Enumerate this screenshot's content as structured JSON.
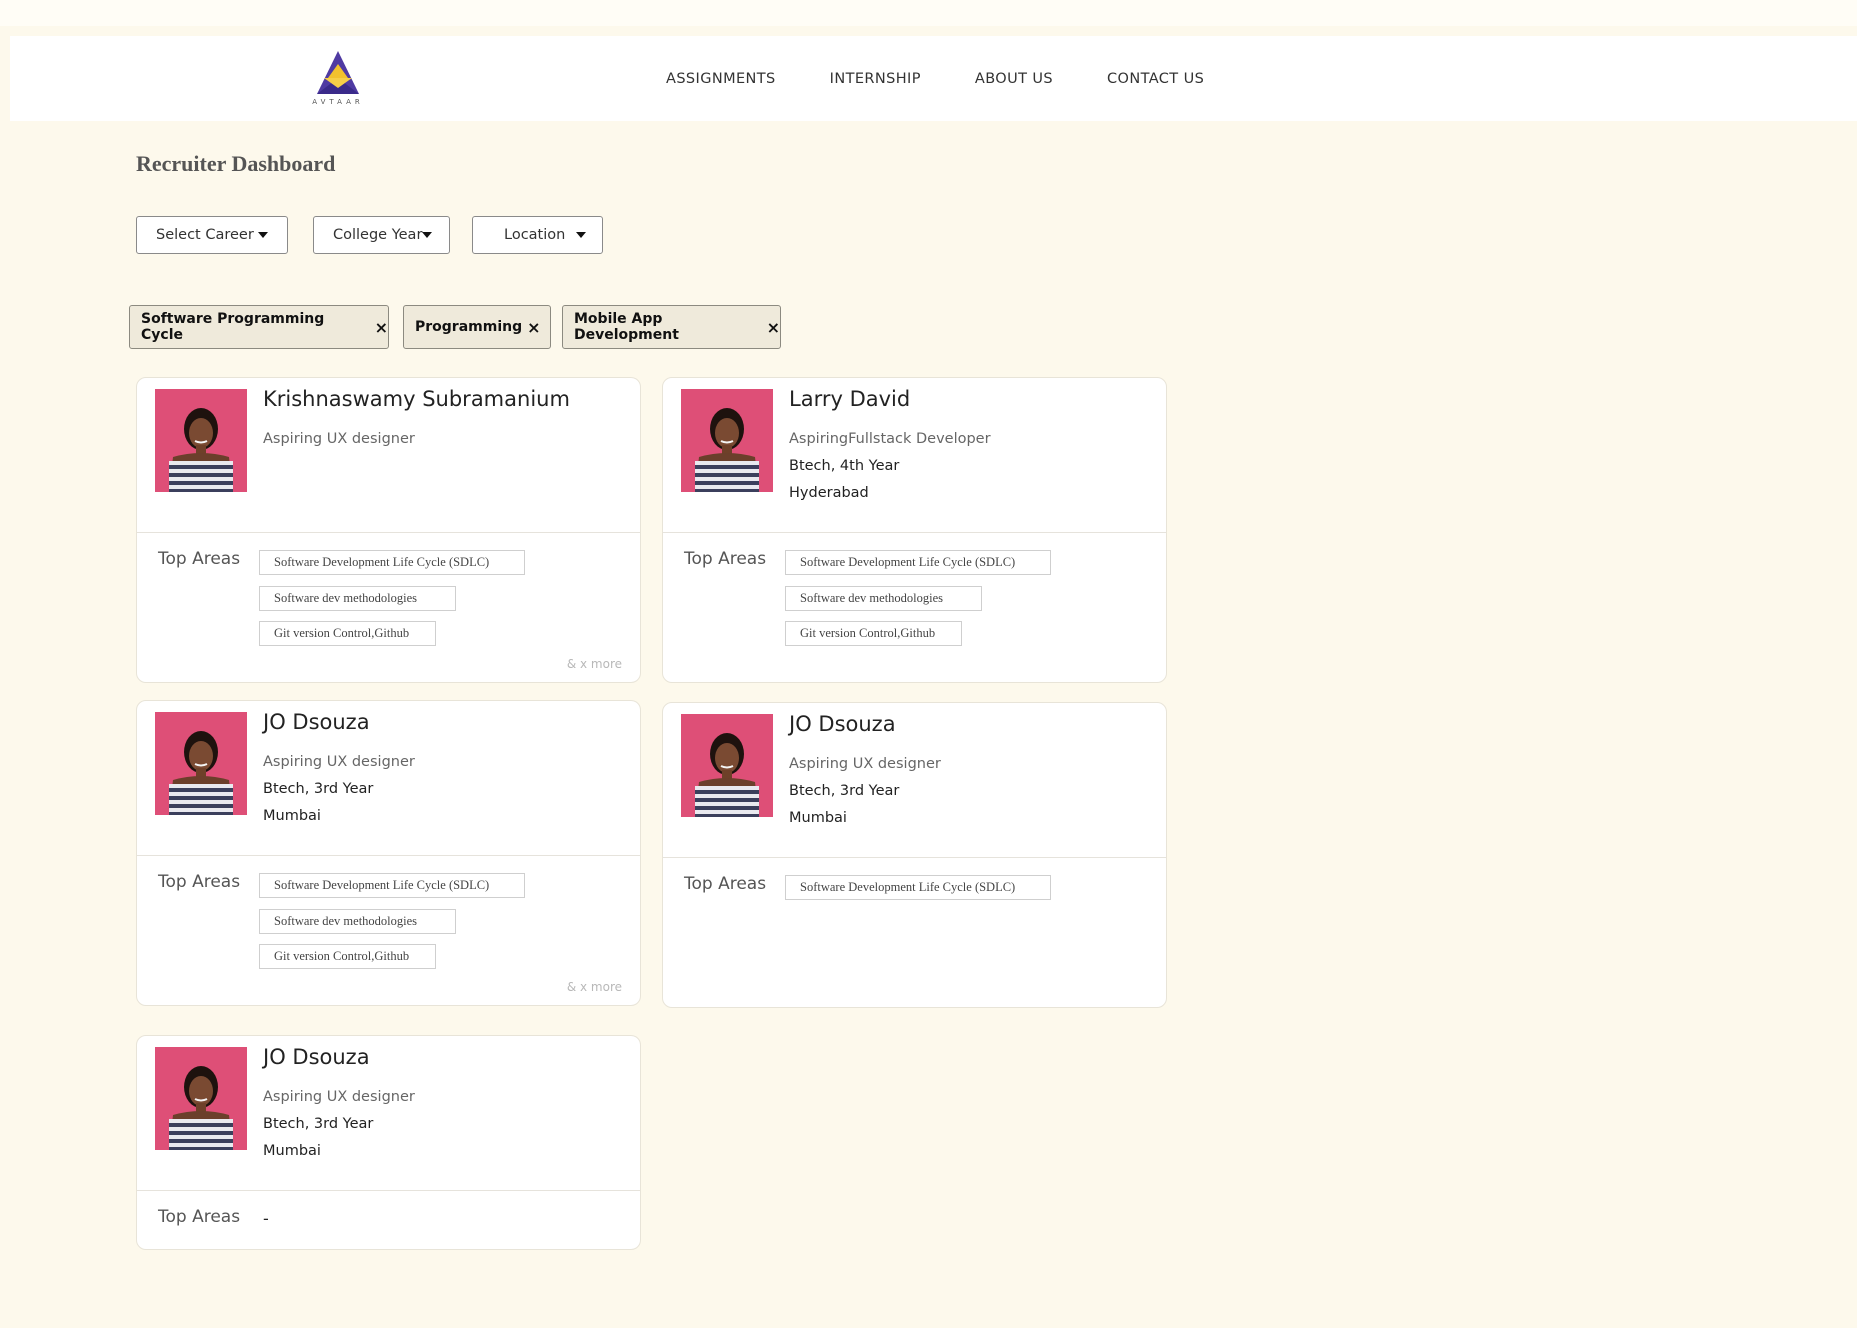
{
  "logo": {
    "text": "AVTAAR"
  },
  "nav": [
    "ASSIGNMENTS",
    "INTERNSHIP",
    "ABOUT US",
    "CONTACT US"
  ],
  "page_title": "Recruiter Dashboard",
  "filters": {
    "career": "Select Career",
    "year": "College Year",
    "location": "Location"
  },
  "chips": [
    {
      "label": "Software Programming Cycle",
      "close": "×"
    },
    {
      "label": "Programming",
      "close": "×"
    },
    {
      "label": "Mobile App Development",
      "close": "×"
    }
  ],
  "top_areas_label": "Top Areas",
  "more_label": "& x more",
  "empty_marker": "-",
  "cards": [
    {
      "name": "Krishnaswamy Subramanium",
      "role": "Aspiring UX designer",
      "education": "",
      "location": "",
      "areas": [
        "Software Development Life Cycle (SDLC)",
        "Software dev methodologies",
        "Git version Control,Github"
      ]
    },
    {
      "name": "Larry David",
      "role": "AspiringFullstack Developer",
      "education": "Btech, 4th Year",
      "location": "Hyderabad",
      "areas": [
        "Software Development Life Cycle (SDLC)",
        "Software dev methodologies",
        "Git version Control,Github"
      ]
    },
    {
      "name": "JO Dsouza",
      "role": "Aspiring UX designer",
      "education": "Btech, 3rd Year",
      "location": "Mumbai",
      "areas": [
        "Software Development Life Cycle (SDLC)",
        "Software dev methodologies",
        "Git version Control,Github"
      ]
    },
    {
      "name": "JO Dsouza",
      "role": "Aspiring UX designer",
      "education": "Btech, 3rd Year",
      "location": "Mumbai",
      "areas": [
        "Software Development Life Cycle (SDLC)"
      ]
    },
    {
      "name": "JO Dsouza",
      "role": "Aspiring UX designer",
      "education": "Btech, 3rd Year",
      "location": "Mumbai",
      "areas": []
    }
  ],
  "colors": {
    "page_bg": "#fdf9ec",
    "chip_bg": "#efeadb",
    "photo_bg": "#e0537a",
    "logo_purple": "#4f3aa2",
    "logo_gold": "#f2c12e"
  }
}
